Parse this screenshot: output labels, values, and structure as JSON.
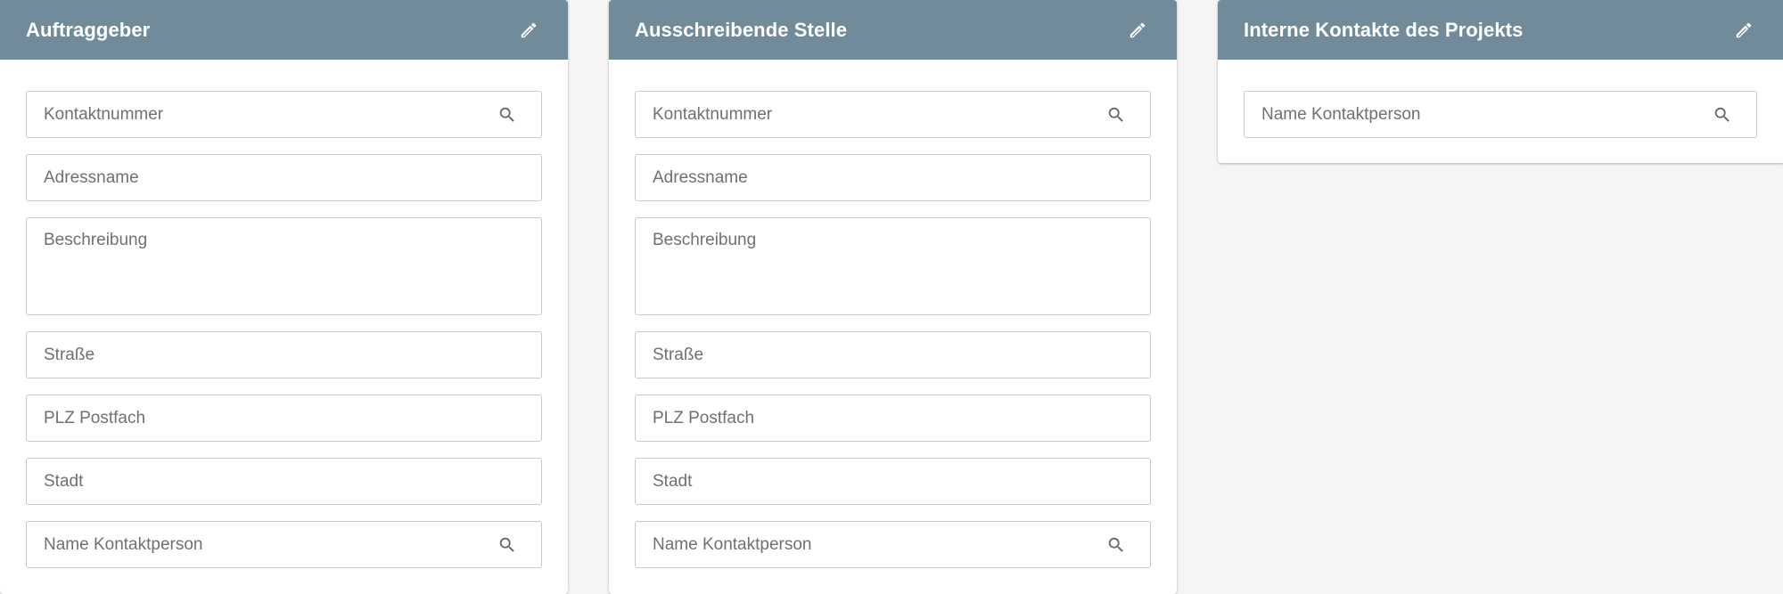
{
  "cards": [
    {
      "title": "Auftraggeber",
      "fields": {
        "kontaktnummer": "Kontaktnummer",
        "adressname": "Adressname",
        "beschreibung": "Beschreibung",
        "strasse": "Straße",
        "plz_postfach": "PLZ Postfach",
        "stadt": "Stadt",
        "name_kontaktperson": "Name Kontaktperson"
      }
    },
    {
      "title": "Ausschreibende Stelle",
      "fields": {
        "kontaktnummer": "Kontaktnummer",
        "adressname": "Adressname",
        "beschreibung": "Beschreibung",
        "strasse": "Straße",
        "plz_postfach": "PLZ Postfach",
        "stadt": "Stadt",
        "name_kontaktperson": "Name Kontaktperson"
      }
    },
    {
      "title": "Interne Kontakte des Projekts",
      "fields": {
        "name_kontaktperson": "Name Kontaktperson"
      }
    }
  ],
  "icons": {
    "edit": "pencil-icon",
    "search": "magnifier-icon"
  },
  "colors": {
    "header": "#718b9b",
    "header_text": "#ffffff",
    "field_border": "#c9c9c9",
    "placeholder": "#707070",
    "icon": "#666666",
    "background": "#f5f5f5"
  }
}
